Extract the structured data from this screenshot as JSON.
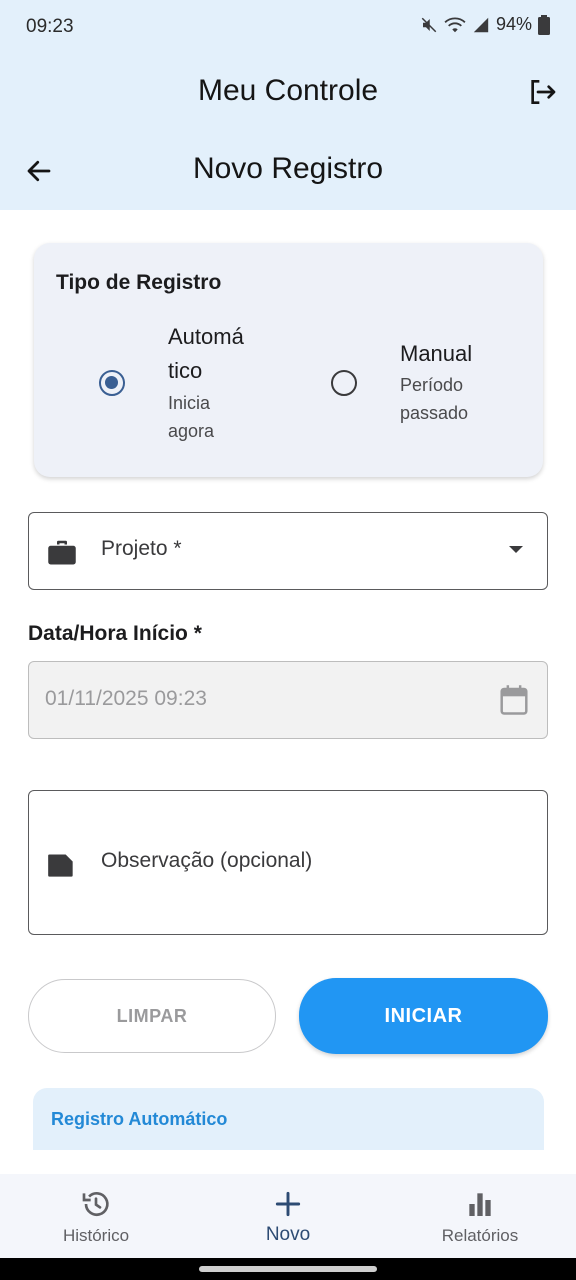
{
  "status_bar": {
    "time": "09:23",
    "battery": "94%"
  },
  "app_bar": {
    "title": "Meu Controle",
    "page_title": "Novo Registro"
  },
  "record_type": {
    "title": "Tipo de Registro",
    "options": [
      {
        "title_line1": "Automá",
        "title_line2": "tico",
        "sub_line1": "Inicia",
        "sub_line2": "agora",
        "selected": true
      },
      {
        "title": "Manual",
        "sub_line1": "Período",
        "sub_line2": "passado",
        "selected": false
      }
    ]
  },
  "project_field": {
    "placeholder": "Projeto *"
  },
  "date_field": {
    "label": "Data/Hora Início *",
    "value": "01/11/2025 09:23"
  },
  "notes_field": {
    "placeholder": "Observação (opcional)"
  },
  "buttons": {
    "clear": "LIMPAR",
    "start": "INICIAR"
  },
  "info_card": {
    "title": "Registro Automático"
  },
  "bottom_nav": {
    "items": [
      {
        "label": "Histórico",
        "icon": "history-icon"
      },
      {
        "label": "Novo",
        "icon": "plus-icon"
      },
      {
        "label": "Relatórios",
        "icon": "bar-chart-icon"
      }
    ]
  },
  "colors": {
    "accent": "#2196f3",
    "header_bg": "#e3f0fb",
    "radio_selected": "#3a5f93"
  }
}
